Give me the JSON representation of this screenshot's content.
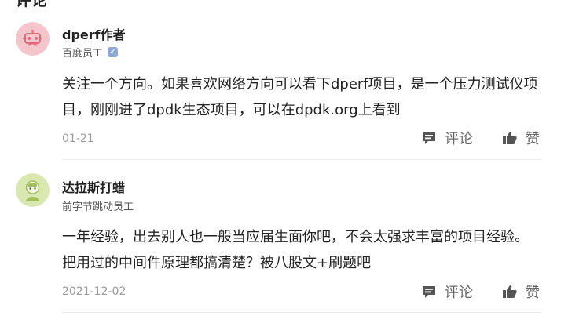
{
  "section": {
    "title": "评论"
  },
  "comments": [
    {
      "author": "dperf作者",
      "role": "百度员工",
      "verified_mark": "✓",
      "text": "关注一个方向。如果喜欢网络方向可以看下dperf项目，是一个压力测试仪项目，刚刚进了dpdk生态项目，可以在dpdk.org上看到",
      "date": "01-21",
      "comment_label": "评论",
      "like_label": "赞"
    },
    {
      "author": "达拉斯打蜡",
      "role": "前字节跳动员工",
      "text": "一年经验，出去别人也一般当应届生面你吧，不会太强求丰富的项目经验。把用过的中间件原理都搞清楚？被八股文+刷题吧",
      "date": "2021-12-02",
      "comment_label": "评论",
      "like_label": "赞"
    }
  ],
  "colors": {
    "avatar1_bg": "#f4c6cc",
    "avatar2_bg": "#d9e8b0",
    "meta_gray": "#9a9a9a",
    "icon_gray": "#555555"
  },
  "icons": {
    "avatar1": "robot-avatar-icon",
    "avatar2": "character-avatar-icon",
    "comment": "speech-bubble-icon",
    "like": "thumbs-up-icon"
  }
}
